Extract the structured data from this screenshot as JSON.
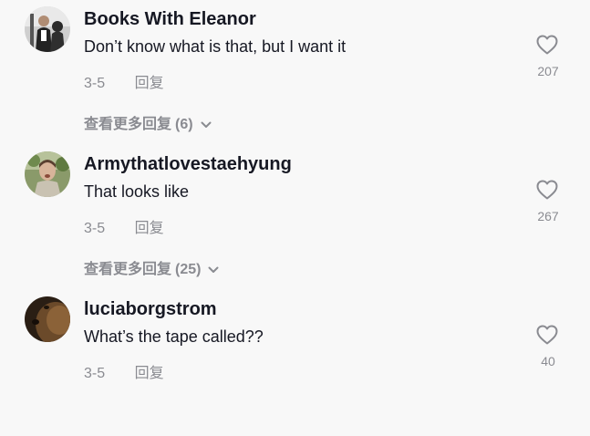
{
  "comments": [
    {
      "username": "Books With Eleanor",
      "text": "Don’t know what is that, but I want it",
      "date": "3-5",
      "reply_label": "回复",
      "likes": "207",
      "more_label": "查看更多回复",
      "more_count": "(6)"
    },
    {
      "username": "Armythatlovestaehyung",
      "text": "That looks like",
      "date": "3-5",
      "reply_label": "回复",
      "likes": "267",
      "more_label": "查看更多回复",
      "more_count": "(25)"
    },
    {
      "username": "luciaborgstrom",
      "text": "What’s the tape called??",
      "date": "3-5",
      "reply_label": "回复",
      "likes": "40"
    }
  ],
  "colors": {
    "background": "#f8f8f8",
    "primary_text": "#161823",
    "secondary_text": "#8a8b91"
  }
}
